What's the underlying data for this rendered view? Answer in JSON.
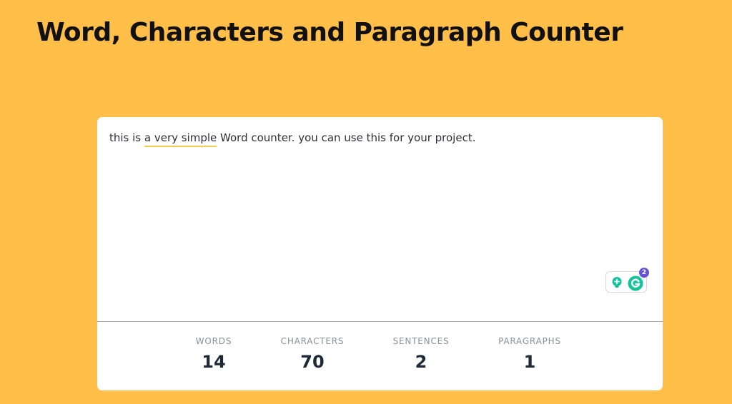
{
  "page": {
    "title": "Word, Characters and Paragraph Counter",
    "background_color": "#ffbf49"
  },
  "editor": {
    "text_before": "this is ",
    "text_underlined": "a very simple",
    "text_after": " Word counter. you can use this for your project.",
    "underline_color": "#f3cf58"
  },
  "grammarly": {
    "suggestion_count": "2",
    "bulb_icon": "lightbulb-icon",
    "logo_icon": "grammarly-g-icon",
    "accent_color": "#15c39a",
    "badge_color": "#6553d6"
  },
  "stats": {
    "words": {
      "label": "WORDS",
      "value": "14"
    },
    "characters": {
      "label": "CHARACTERS",
      "value": "70"
    },
    "sentences": {
      "label": "SENTENCES",
      "value": "2"
    },
    "paragraphs": {
      "label": "PARAGRAPHS",
      "value": "1"
    }
  }
}
